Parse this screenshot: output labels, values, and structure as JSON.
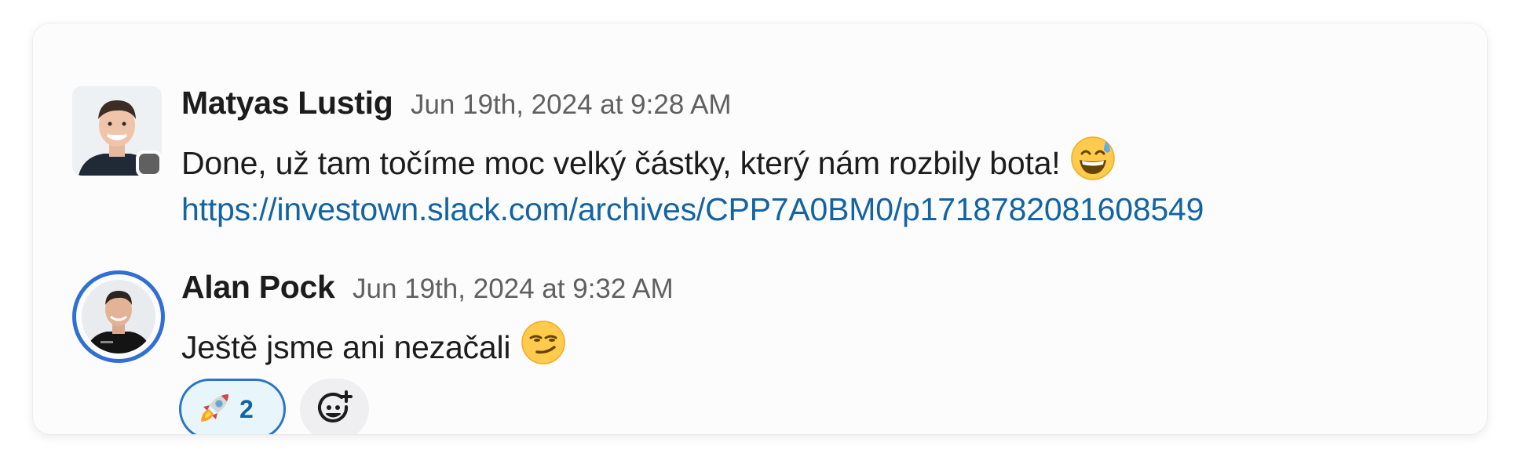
{
  "messages": [
    {
      "author": "Matyas Lustig",
      "timestamp": "Jun 19th, 2024 at 9:28 AM",
      "text": "Done, už tam točíme moc velký částky, který nám rozbily bota!",
      "emoji": "sweat-smile-emoji",
      "link": "https://investown.slack.com/archives/CPP7A0BM0/p1718782081608549",
      "avatar": "avatar-photo",
      "presence": "away"
    },
    {
      "author": "Alan Pock",
      "timestamp": "Jun 19th, 2024 at 9:32 AM",
      "text": "Ještě jsme ani nezačali",
      "emoji": "smirk-emoji",
      "avatar": "avatar-photo",
      "reactions": [
        {
          "emoji": "rocket-emoji",
          "count": "2",
          "selected": true
        }
      ],
      "add_reaction": "add-reaction-icon"
    }
  ],
  "colors": {
    "link": "#1264a3",
    "reaction_border": "#2a74c9",
    "reaction_bg": "#e8f5fa",
    "avatar_ring": "#2f6fd6",
    "timestamp": "#616061"
  }
}
